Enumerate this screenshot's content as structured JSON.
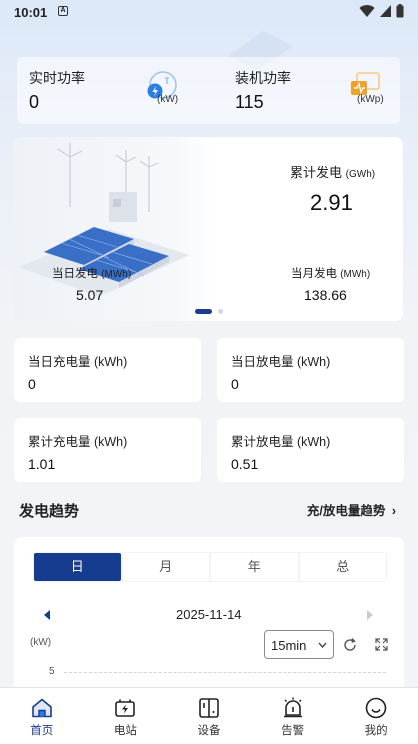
{
  "status_bar": {
    "time": "10:01",
    "app_icon_letter": "A"
  },
  "power": {
    "realtime": {
      "label": "实时功率",
      "value": "0",
      "unit": "(kW)"
    },
    "installed": {
      "label": "装机功率",
      "value": "115",
      "unit": "(kWp)"
    }
  },
  "generation": {
    "total": {
      "label": "累计发电",
      "unit": "(GWh)",
      "value": "2.91"
    },
    "today": {
      "label": "当日发电",
      "unit": "(MWh)",
      "value": "5.07"
    },
    "month": {
      "label": "当月发电",
      "unit": "(MWh)",
      "value": "138.66"
    },
    "page_count": 2,
    "active_page": 1
  },
  "storage": [
    {
      "label": "当日充电量 (kWh)",
      "value": "0"
    },
    {
      "label": "当日放电量 (kWh)",
      "value": "0"
    },
    {
      "label": "累计充电量 (kWh)",
      "value": "1.01"
    },
    {
      "label": "累计放电量 (kWh)",
      "value": "0.51"
    }
  ],
  "trend": {
    "title": "发电趋势",
    "link": "充/放电量趋势",
    "tabs": [
      "日",
      "月",
      "年",
      "总"
    ],
    "active_tab": 0,
    "date": "2025-11-14",
    "interval": "15min",
    "y_unit": "(kW)",
    "y_tick": "5"
  },
  "nav": [
    {
      "label": "首页",
      "icon": "home-icon",
      "active": true
    },
    {
      "label": "电站",
      "icon": "station-icon",
      "active": false
    },
    {
      "label": "设备",
      "icon": "device-icon",
      "active": false
    },
    {
      "label": "告警",
      "icon": "alarm-icon",
      "active": false
    },
    {
      "label": "我的",
      "icon": "profile-icon",
      "active": false
    }
  ],
  "colors": {
    "primary": "#153c8e",
    "accent_blue": "#2a7de1",
    "accent_orange": "#f0a12a"
  }
}
